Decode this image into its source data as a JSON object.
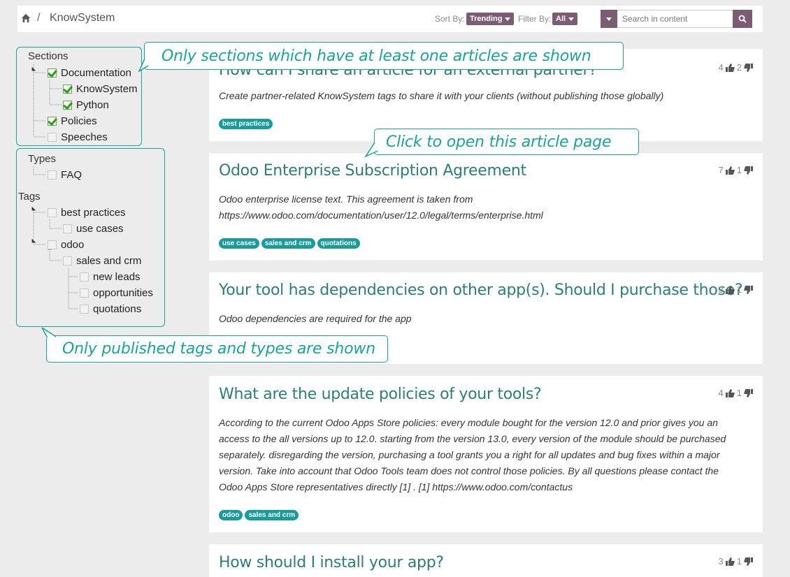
{
  "breadcrumb": {
    "separator": "/",
    "current": "KnowSystem"
  },
  "toolbar": {
    "sort_label": "Sort By:",
    "sort_value": "Trending",
    "filter_label": "Filter By:",
    "filter_value": "All",
    "search_placeholder": "Search in content"
  },
  "sidebar": {
    "sections_heading": "Sections",
    "sections": [
      {
        "label": "Documentation",
        "checked": true
      },
      {
        "label": "KnowSystem",
        "checked": true
      },
      {
        "label": "Python",
        "checked": true
      },
      {
        "label": "Policies",
        "checked": true
      },
      {
        "label": "Speeches",
        "checked": false
      }
    ],
    "types_heading": "Types",
    "types": [
      {
        "label": "FAQ",
        "checked": false
      }
    ],
    "tags_heading": "Tags",
    "tags": [
      {
        "label": "best practices",
        "checked": false
      },
      {
        "label": "use cases",
        "checked": false
      },
      {
        "label": "odoo",
        "checked": false
      },
      {
        "label": "sales and crm",
        "checked": false
      },
      {
        "label": "new leads",
        "checked": false
      },
      {
        "label": "opportunities",
        "checked": false
      },
      {
        "label": "quotations",
        "checked": false
      }
    ]
  },
  "articles": [
    {
      "title": "How can I share an article for an external partner?",
      "description": "Create partner-related KnowSystem tags to share it with your clients (without publishing those globally)",
      "likes": "4",
      "dislikes": "2",
      "tags": [
        "best practices"
      ]
    },
    {
      "title": "Odoo Enterprise Subscription Agreement",
      "description": "Odoo enterprise license text. This agreement is taken from https://www.odoo.com/documentation/user/12.0/legal/terms/enterprise.html",
      "likes": "7",
      "dislikes": "1",
      "tags": [
        "use cases",
        "sales and crm",
        "quotations"
      ]
    },
    {
      "title": "Your tool has dependencies on other app(s). Should I purchase those?",
      "description": "Odoo dependencies are required for the app",
      "likes": "3",
      "dislikes": "1",
      "tags": []
    },
    {
      "title": "What are the update policies of your tools?",
      "description": "According to the current Odoo Apps Store policies: every module bought for the version 12.0 and prior gives you an access to the all versions up to 12.0. starting from the version 13.0, every version of the module should be purchased separately. disregarding the version, purchasing a tool grants you a right for all updates and bug fixes within a major version. Take into account that Odoo Tools team does not control those policies. By all questions please contact the Odoo Apps Store representatives directly [1] . [1] https://www.odoo.com/contactus",
      "likes": "4",
      "dislikes": "1",
      "tags": [
        "odoo",
        "sales and crm"
      ]
    },
    {
      "title": "How should I install your app?",
      "description": "",
      "likes": "3",
      "dislikes": "1",
      "tags": []
    }
  ],
  "callouts": {
    "sections_note": "Only sections which have at least one articles are shown",
    "article_note": "Click to open this article page",
    "tags_note": "Only published tags and types are shown"
  },
  "colors": {
    "accent": "#7c5c72",
    "teal": "#1aa39a",
    "title": "#2d7d7a",
    "tag": "#1a9b9b"
  },
  "icons": {
    "home": "home-icon",
    "like": "thumbs-up-icon",
    "dislike": "thumbs-down-icon",
    "search": "search-icon"
  }
}
